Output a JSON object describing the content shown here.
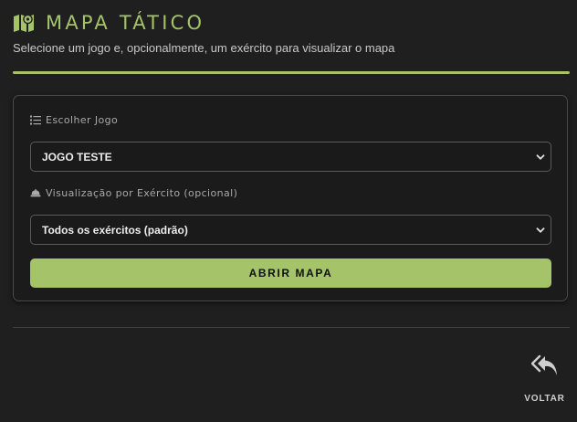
{
  "header": {
    "title": "MAPA TÁTICO",
    "subtitle": "Selecione um jogo e, opcionalmente, um exército para visualizar o mapa",
    "icon": "map-icon"
  },
  "form": {
    "game": {
      "label": "Escolher Jogo",
      "icon": "list-icon",
      "selected": "JOGO TESTE"
    },
    "army": {
      "label": "Visualização por Exército (opcional)",
      "icon": "helmet-icon",
      "selected": "Todos os exércitos (padrão)"
    },
    "open_button_label": "ABRIR MAPA"
  },
  "footer": {
    "back_label": "VOLTAR",
    "back_icon": "reply-all-icon"
  },
  "colors": {
    "accent": "#a5c46a",
    "background": "#1f1f1f",
    "card": "#1b1b1b"
  }
}
